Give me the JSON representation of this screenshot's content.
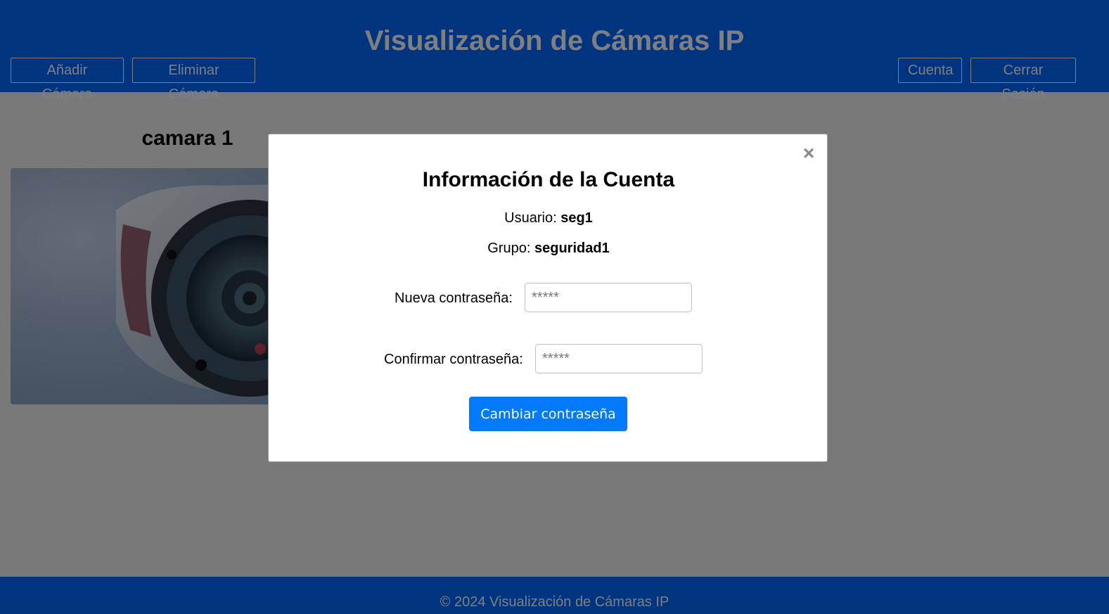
{
  "header": {
    "title": "Visualización de Cámaras IP",
    "add_camera_label": "Añadir Cámara",
    "delete_camera_label": "Eliminar Cámara",
    "account_label": "Cuenta",
    "logout_label": "Cerrar Sesión"
  },
  "cameras": [
    {
      "name": "camara 1"
    }
  ],
  "footer": {
    "text": "© 2024 Visualización de Cámaras IP"
  },
  "modal": {
    "close_icon": "close-icon",
    "close_symbol": "×",
    "title": "Información de la Cuenta",
    "user_label": "Usuario:",
    "user_value": "seg1",
    "group_label": "Grupo:",
    "group_value": "seguridad1",
    "new_password_label": "Nueva contraseña:",
    "new_password_placeholder": "*****",
    "confirm_password_label": "Confirmar contraseña:",
    "confirm_password_placeholder": "*****",
    "change_button_label": "Cambiar contraseña"
  },
  "colors": {
    "primary": "#0068ff",
    "button": "#007bff",
    "overlay": "rgba(0,0,0,0.5)"
  }
}
